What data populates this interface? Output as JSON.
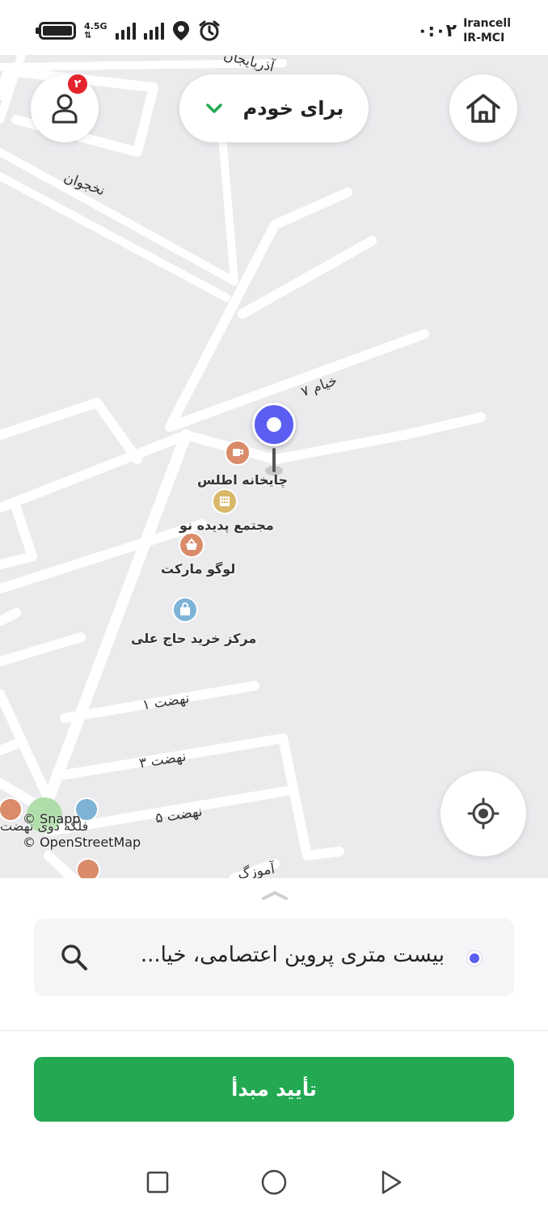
{
  "status_bar": {
    "carrier_line1": "Irancell",
    "carrier_line2": "IR-MCI",
    "time": "۰:۰۲",
    "network_type_top": "4.5G",
    "network_type_bottom": "⇅",
    "icons": [
      "battery-icon",
      "signal-icon",
      "signal-icon",
      "location-icon",
      "alarm-icon"
    ]
  },
  "top_bar": {
    "ride_for": "برای خودم",
    "notification_count": "۲",
    "icons": [
      "user-icon",
      "chevron-down-icon",
      "home-icon"
    ]
  },
  "map": {
    "streets": [
      "آذربایجان",
      "نخجوان",
      "خیام ۷",
      "نهضت ۱",
      "نهضت ۳",
      "نهضت ۵",
      "آموزگ"
    ],
    "pois": [
      {
        "name": "چایخانه اطلس",
        "icon": "tea-icon",
        "color": "#d98b6a"
      },
      {
        "name": "مجتمع پدیده نو",
        "icon": "building-icon",
        "color": "#d9b86a"
      },
      {
        "name": "لوگو مارکت",
        "icon": "basket-icon",
        "color": "#d98b6a"
      },
      {
        "name": "مرکز خرید حاج علی",
        "icon": "shopping-bag-icon",
        "color": "#7fb3d6"
      }
    ],
    "partial_labels": [
      "فلکه دوی نهضت"
    ],
    "credit_snapp": "© Snapp",
    "credit_osm": "© OpenStreetMap",
    "pin_color": "#5b5ef0"
  },
  "sheet": {
    "address": "بیست متری پروین اعتصامی، خیا...",
    "confirm_label": "تأیید مبدأ",
    "confirm_color": "#22a952"
  },
  "nav_bar": {
    "icons": [
      "recent-apps-icon",
      "home-circle-icon",
      "back-icon"
    ]
  }
}
